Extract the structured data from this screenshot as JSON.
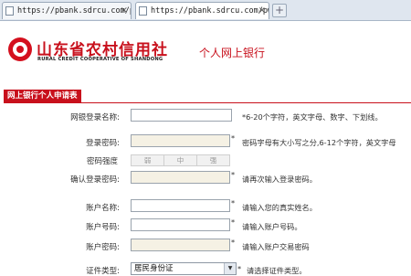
{
  "browser": {
    "tabs": [
      {
        "url": "https://pbank.sdrcu.com/pw"
      },
      {
        "url": "https://pbank.sdrcu.com/pw"
      }
    ],
    "close_glyph": "×",
    "newtab_glyph": "+"
  },
  "header": {
    "bank_name_cn": "山东省农村信用社",
    "bank_name_en": "RURAL CREDIT COOPERATIVE OF SHANDONG",
    "page_title": "个人网上银行",
    "logo_color": "#d4101e"
  },
  "section": {
    "title": "网上银行个人申请表"
  },
  "form": {
    "login_name": {
      "label": "网银登录名称:",
      "hint": "*6-20个字符，英文字母、数字、下划线。"
    },
    "login_password": {
      "label": "登录密码:",
      "hint": "密码字母有大小写之分,6-12个字符，英文字母"
    },
    "password_strength": {
      "label": "密码强度",
      "levels": [
        "弱",
        "中",
        "强"
      ]
    },
    "confirm_password": {
      "label": "确认登录密码:",
      "hint": "请再次输入登录密码。"
    },
    "account_name": {
      "label": "账户名称:",
      "hint": "请输入您的真实姓名。"
    },
    "account_number": {
      "label": "账户号码:",
      "hint": "请输入账户号码。"
    },
    "account_password": {
      "label": "账户密码:",
      "hint": "请输入账户交易密码"
    },
    "id_type": {
      "label": "证件类型:",
      "value": "居民身份证",
      "hint": "请选择证件类型。"
    },
    "required_mark": "*"
  },
  "colors": {
    "brand_red": "#c8101c",
    "password_field_bg": "#f5f1e4"
  }
}
